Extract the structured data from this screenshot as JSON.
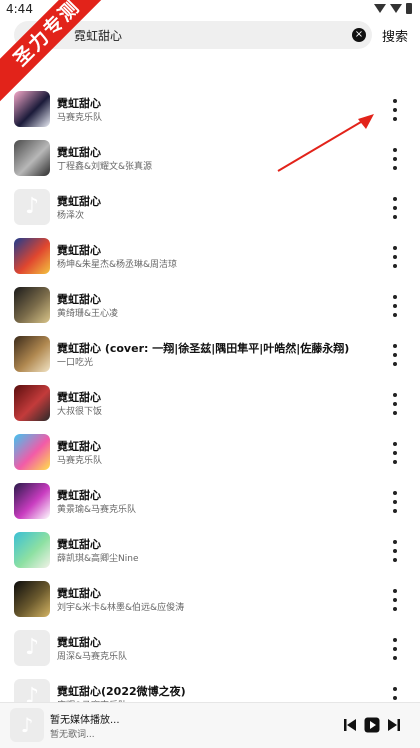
{
  "status": {
    "time": "4:44"
  },
  "search": {
    "value": "霓虹甜心",
    "clear_icon": "×",
    "button_label": "搜索"
  },
  "ribbon": {
    "text": "圣力专测"
  },
  "songs": [
    {
      "title": "霓虹甜心",
      "artist": "马赛克乐队",
      "thumb": "art"
    },
    {
      "title": "霓虹甜心",
      "artist": "丁程鑫&刘耀文&张真源",
      "thumb": "art"
    },
    {
      "title": "霓虹甜心",
      "artist": "杨泽次",
      "thumb": "placeholder"
    },
    {
      "title": "霓虹甜心",
      "artist": "杨坤&朱星杰&杨丞琳&周洁琼",
      "thumb": "art"
    },
    {
      "title": "霓虹甜心",
      "artist": "黄绮珊&王心凌",
      "thumb": "art"
    },
    {
      "title": "霓虹甜心 (cover: 一翔|徐圣兹|隅田隼平|叶皓然|佐藤永翔)",
      "artist": "一口吃光",
      "thumb": "art"
    },
    {
      "title": "霓虹甜心",
      "artist": "大叔很下饭",
      "thumb": "art"
    },
    {
      "title": "霓虹甜心",
      "artist": "马赛克乐队",
      "thumb": "art"
    },
    {
      "title": "霓虹甜心",
      "artist": "黄景瑜&马赛克乐队",
      "thumb": "art"
    },
    {
      "title": "霓虹甜心",
      "artist": "薛凯琪&高卿尘Nine",
      "thumb": "art"
    },
    {
      "title": "霓虹甜心",
      "artist": "刘宇&米卡&林墨&伯远&应俊涛",
      "thumb": "art"
    },
    {
      "title": "霓虹甜心",
      "artist": "周深&马赛克乐队",
      "thumb": "placeholder"
    },
    {
      "title": "霓虹甜心(2022微博之夜)",
      "artist": "康辉&马赛克乐队",
      "thumb": "placeholder"
    }
  ],
  "player": {
    "title": "暂无媒体播放...",
    "subtitle": "暂无歌词..."
  },
  "colors": {
    "accent": "#e2231a",
    "text": "#111111",
    "muted": "#666666"
  }
}
